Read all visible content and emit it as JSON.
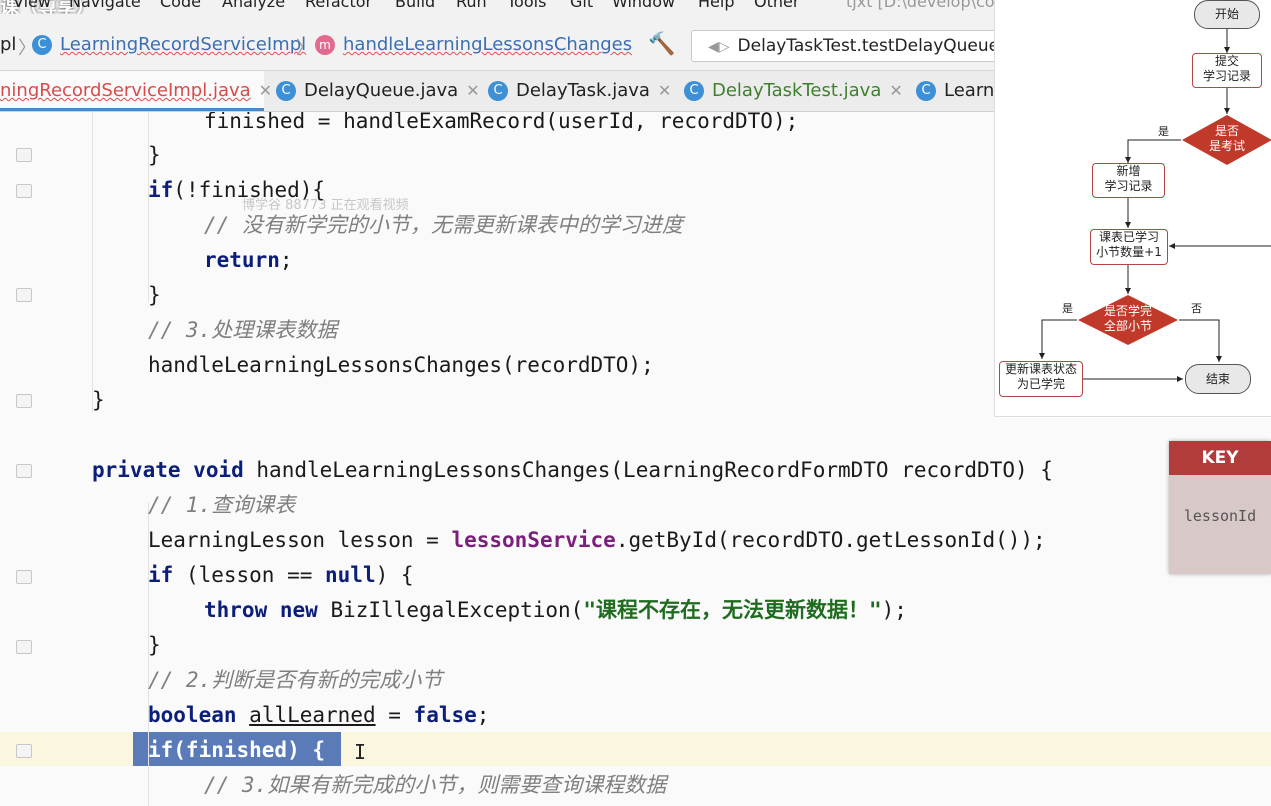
{
  "menubar": {
    "watermark": "课（尊享）",
    "items": [
      "View",
      "Navigate",
      "Code",
      "Analyze",
      "Refactor",
      "Build",
      "Run",
      "Tools",
      "Git",
      "Window",
      "Help",
      "Other"
    ],
    "project": "tjxt [D:\\develop\\co"
  },
  "navbar": {
    "crumb_prefix": "pl",
    "crumb_class": "LearningRecordServiceImpl",
    "crumb_method": "handleLearningLessonsChanges",
    "run_config": "DelayTaskTest.testDelayQueue"
  },
  "tabs": [
    {
      "label": "ningRecordServiceImpl.java",
      "state": "active"
    },
    {
      "label": "DelayQueue.java",
      "state": "normal"
    },
    {
      "label": "DelayTask.java",
      "state": "normal"
    },
    {
      "label": "DelayTaskTest.java",
      "state": "green"
    },
    {
      "label": "Learni",
      "state": "normal"
    }
  ],
  "watch_watermark": "博学谷 88773 正在观看视频",
  "code": {
    "l1": "finished = handleExamRecord(userId, recordDTO);",
    "l2": "}",
    "l3_kw": "if",
    "l3_rest": "(!finished){",
    "l4": "// 没有新学完的小节，无需更新课表中的学习进度",
    "l5_kw": "return",
    "l5_rest": ";",
    "l6": "}",
    "l7": "// 3.处理课表数据",
    "l8": "handleLearningLessonsChanges(recordDTO);",
    "l9": "}",
    "l10_kw1": "private",
    "l10_kw2": "void",
    "l10_rest": "handleLearningLessonsChanges(LearningRecordFormDTO recordDTO) {",
    "l11": "// 1.查询课表",
    "l12_a": "LearningLesson lesson = ",
    "l12_fld": "lessonService",
    "l12_b": ".getById(recordDTO.getLessonId());",
    "l13_kw": "if",
    "l13_a": " (lesson == ",
    "l13_kw2": "null",
    "l13_b": ") {",
    "l14_kw1": "throw",
    "l14_kw2": "new",
    "l14_a": "BizIllegalException(",
    "l14_str": "\"课程不存在，无法更新数据！\"",
    "l14_b": ");",
    "l15": "}",
    "l16": "// 2.判断是否有新的完成小节",
    "l17_kw": "boolean",
    "l17_var": "allLearned",
    "l17_mid": " = ",
    "l17_kw2": "false",
    "l17_end": ";",
    "l18": "if(finished) {",
    "l19": "// 3.如果有新完成的小节，则需要查询课程数据"
  },
  "flow": {
    "start": "开始",
    "submit1": "提交",
    "submit2": "学习记录",
    "exam1": "是否",
    "exam2": "是考试",
    "yes1": "是",
    "add1": "新增",
    "add2": "学习记录",
    "count1": "课表已学习",
    "count2": "小节数量+1",
    "all1": "是否学完",
    "all2": "全部小节",
    "yes2": "是",
    "no2": "否",
    "upd1": "更新课表状态",
    "upd2": "为已学完",
    "end": "结束",
    "colors": {
      "diamond": "#c0392b",
      "box_border": "#b54646"
    }
  },
  "key": {
    "header": "KEY",
    "value": "lessonId",
    "color": "#b23b3b"
  }
}
